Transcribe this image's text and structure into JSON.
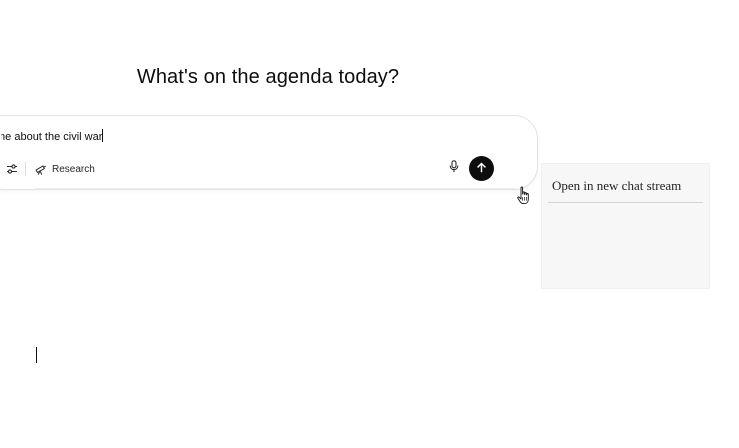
{
  "heading": "What's on the agenda today?",
  "composer": {
    "prompt_text": "me about the civil war",
    "tools_icon": "sliders-icon",
    "research_label": "Research",
    "research_icon": "telescope-icon",
    "mic_icon": "microphone-icon",
    "send_icon": "arrow-up-icon"
  },
  "context_menu": {
    "items": [
      {
        "label": "Open in new chat stream"
      }
    ]
  },
  "cursor": "hand-pointer"
}
